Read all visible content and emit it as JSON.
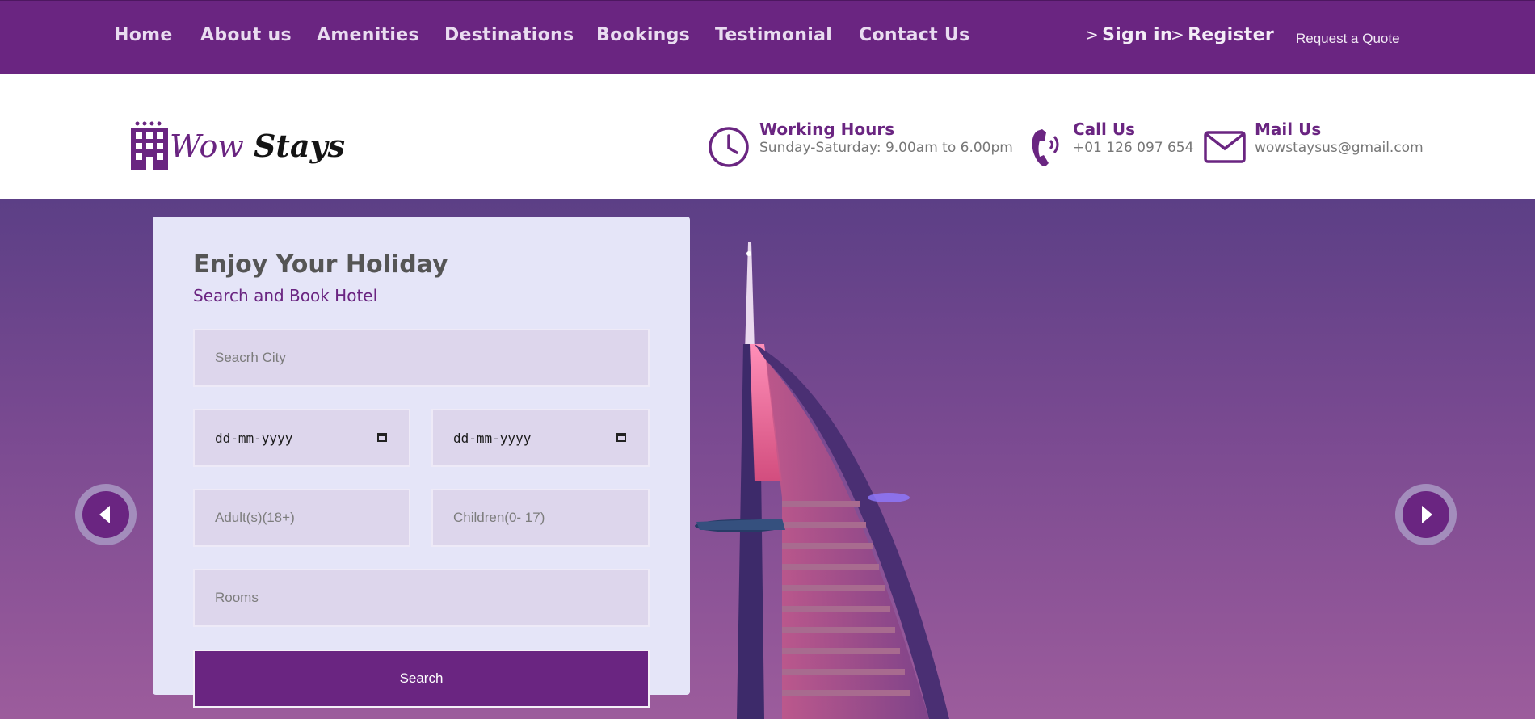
{
  "nav": {
    "links": [
      "Home",
      "About us",
      "Amenities",
      "Destinations",
      "Bookings",
      "Testimonial",
      "Contact Us"
    ],
    "sign_in": "Sign in",
    "register": "Register",
    "quote": "Request a Quote",
    "chevron": ">"
  },
  "logo": {
    "word1": "Wow",
    "word2": "Stays"
  },
  "header": {
    "working_hours": {
      "title": "Working Hours",
      "value": "Sunday-Saturday: 9.00am to 6.00pm",
      "icon": "clock-icon"
    },
    "call": {
      "title": "Call Us",
      "value": "+01 126 097 654",
      "icon": "phone-icon"
    },
    "mail": {
      "title": "Mail Us",
      "value": "wowstaysus@gmail.com",
      "icon": "mail-icon"
    }
  },
  "booking": {
    "title": "Enjoy Your Holiday",
    "subtitle": "Search and Book Hotel",
    "city_placeholder": "Seacrh City",
    "checkin_value": "dd-mm-yyyy",
    "checkout_value": "dd-mm-yyyy",
    "adults_placeholder": "Adult(s)(18+)",
    "children_placeholder": "Children(0- 17)",
    "rooms_placeholder": "Rooms",
    "search_label": "Search"
  },
  "colors": {
    "brand": "#6a2581",
    "panel": "#e5e5f8",
    "field": "#ddd6ec"
  }
}
